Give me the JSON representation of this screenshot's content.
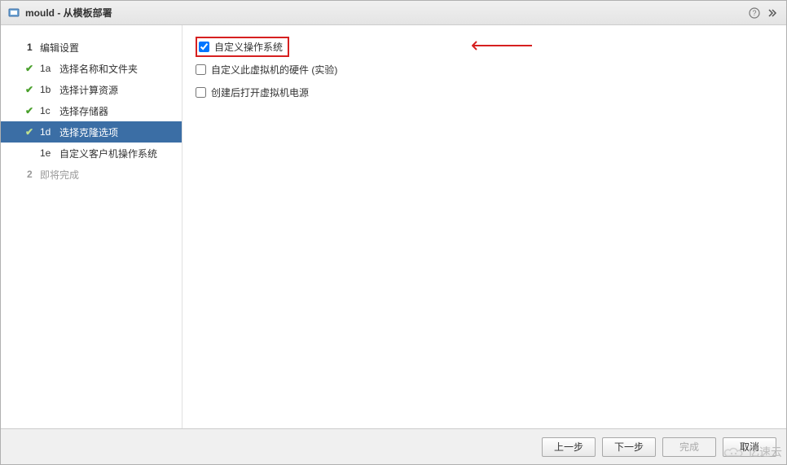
{
  "titlebar": {
    "title": "mould - 从模板部署"
  },
  "sidebar": {
    "steps": {
      "s1": {
        "num": "1",
        "label": "编辑设置"
      },
      "s1a": {
        "num": "1a",
        "label": "选择名称和文件夹"
      },
      "s1b": {
        "num": "1b",
        "label": "选择计算资源"
      },
      "s1c": {
        "num": "1c",
        "label": "选择存储器"
      },
      "s1d": {
        "num": "1d",
        "label": "选择克隆选项"
      },
      "s1e": {
        "num": "1e",
        "label": "自定义客户机操作系统"
      },
      "s2": {
        "num": "2",
        "label": "即将完成"
      }
    }
  },
  "content": {
    "opt1": "自定义操作系统",
    "opt2": "自定义此虚拟机的硬件 (实验)",
    "opt3": "创建后打开虚拟机电源"
  },
  "footer": {
    "back": "上一步",
    "next": "下一步",
    "finish": "完成",
    "cancel": "取消"
  },
  "watermark": {
    "text": "亿速云"
  }
}
